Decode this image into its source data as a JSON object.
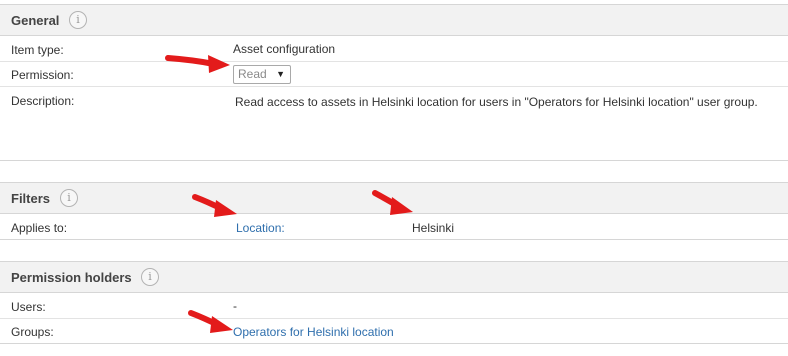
{
  "general": {
    "title": "General",
    "info_glyph": "i",
    "item_type_label": "Item type:",
    "item_type_value": "Asset configuration",
    "permission_label": "Permission:",
    "permission_value": "Read",
    "description_label": "Description:",
    "description_value": "Read access to assets in Helsinki location for users in \"Operators for Helsinki location\" user group."
  },
  "filters": {
    "title": "Filters",
    "info_glyph": "i",
    "applies_to_label": "Applies to:",
    "filter_type": "Location:",
    "filter_value": "Helsinki"
  },
  "permission_holders": {
    "title": "Permission holders",
    "info_glyph": "i",
    "users_label": "Users:",
    "users_value": "-",
    "groups_label": "Groups:",
    "groups_value": "Operators for Helsinki location"
  },
  "icons": {
    "info": "info-circle-icon",
    "annotation": "red-arrow-icon",
    "dropdown": "caret-down-icon"
  },
  "colors": {
    "link": "#2f6fad",
    "arrow": "#e31b1b",
    "header_bg": "#f2f2f2"
  }
}
